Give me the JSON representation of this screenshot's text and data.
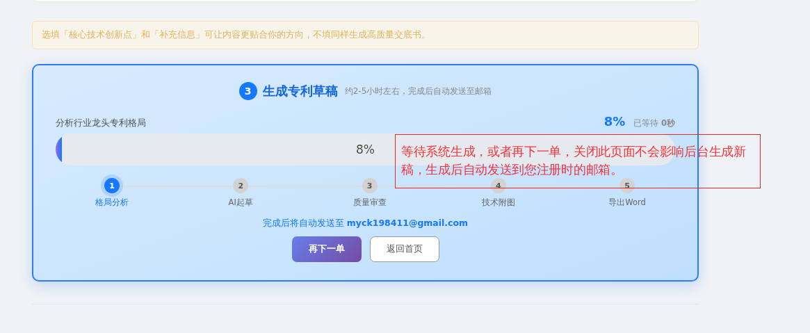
{
  "notice": "选填「核心技术创新点」和「补充信息」可让内容更贴合你的方向，不填同样生成高质量交底书。",
  "step": {
    "number": "3",
    "title": "生成专利草稿",
    "subtitle": "约2-5小时左右，完成后自动发送至邮箱"
  },
  "progress": {
    "label": "分析行业龙头专利格局",
    "percent": "8%",
    "waited": "已等待 **0秒**",
    "level": 0.01,
    "bar_text": "8%"
  },
  "stages": [
    {
      "number": "1",
      "label": "格局分析",
      "selected": true
    },
    {
      "number": "2",
      "label": "AI起草",
      "selected": false
    },
    {
      "number": "3",
      "label": "质量审查",
      "selected": false
    },
    {
      "number": "4",
      "label": "技术附图",
      "selected": false
    },
    {
      "number": "5",
      "label": "导出Word",
      "selected": false
    }
  ],
  "email_note": "完成后将自动发送至 **myck198411@gmail.com**",
  "buttons": [
    {
      "label": "再下一单",
      "kind": "primary"
    },
    {
      "label": "返回首页",
      "kind": "secondary"
    }
  ],
  "annotation": "等待系统生成，或者再下一单，关闭此页面不会影响后台生成新稿，生成后自动发送到您注册时的邮箱。"
}
